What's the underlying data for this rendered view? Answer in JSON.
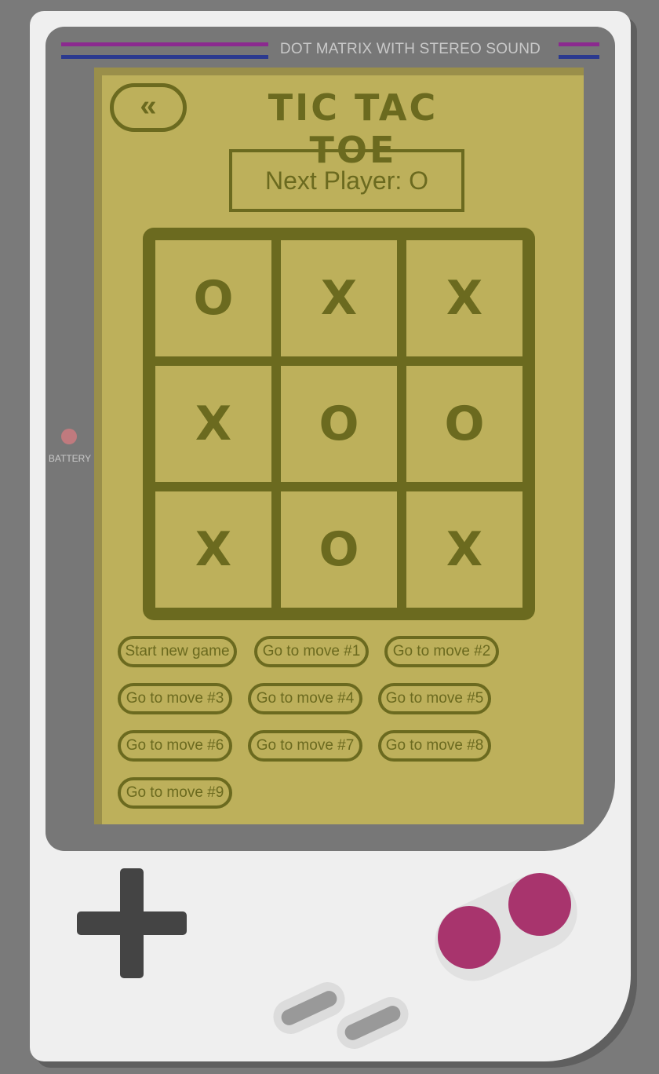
{
  "console": {
    "brand_text": "DOT MATRIX WITH STEREO SOUND",
    "battery_label": "BATTERY",
    "colors": {
      "body": "#efefef",
      "bezel": "#777777",
      "screen": "#bdb05b",
      "ink": "#6b6a1f",
      "accent_purple": "#8b2a8f",
      "accent_blue": "#2b3a8f",
      "button_magenta": "#a8346d"
    }
  },
  "header": {
    "back_label": "«",
    "title": "TIC TAC TOE"
  },
  "status": {
    "text": "Next Player: O"
  },
  "board": {
    "cells": [
      "O",
      "X",
      "X",
      "X",
      "O",
      "O",
      "X",
      "O",
      "X"
    ]
  },
  "history": {
    "buttons": [
      "Start new game",
      "Go to move #1",
      "Go to move #2",
      "Go to move #3",
      "Go to move #4",
      "Go to move #5",
      "Go to move #6",
      "Go to move #7",
      "Go to move #8",
      "Go to move #9"
    ]
  },
  "icons": {
    "back": "double-chevron-left-icon",
    "dpad": "dpad-icon"
  }
}
